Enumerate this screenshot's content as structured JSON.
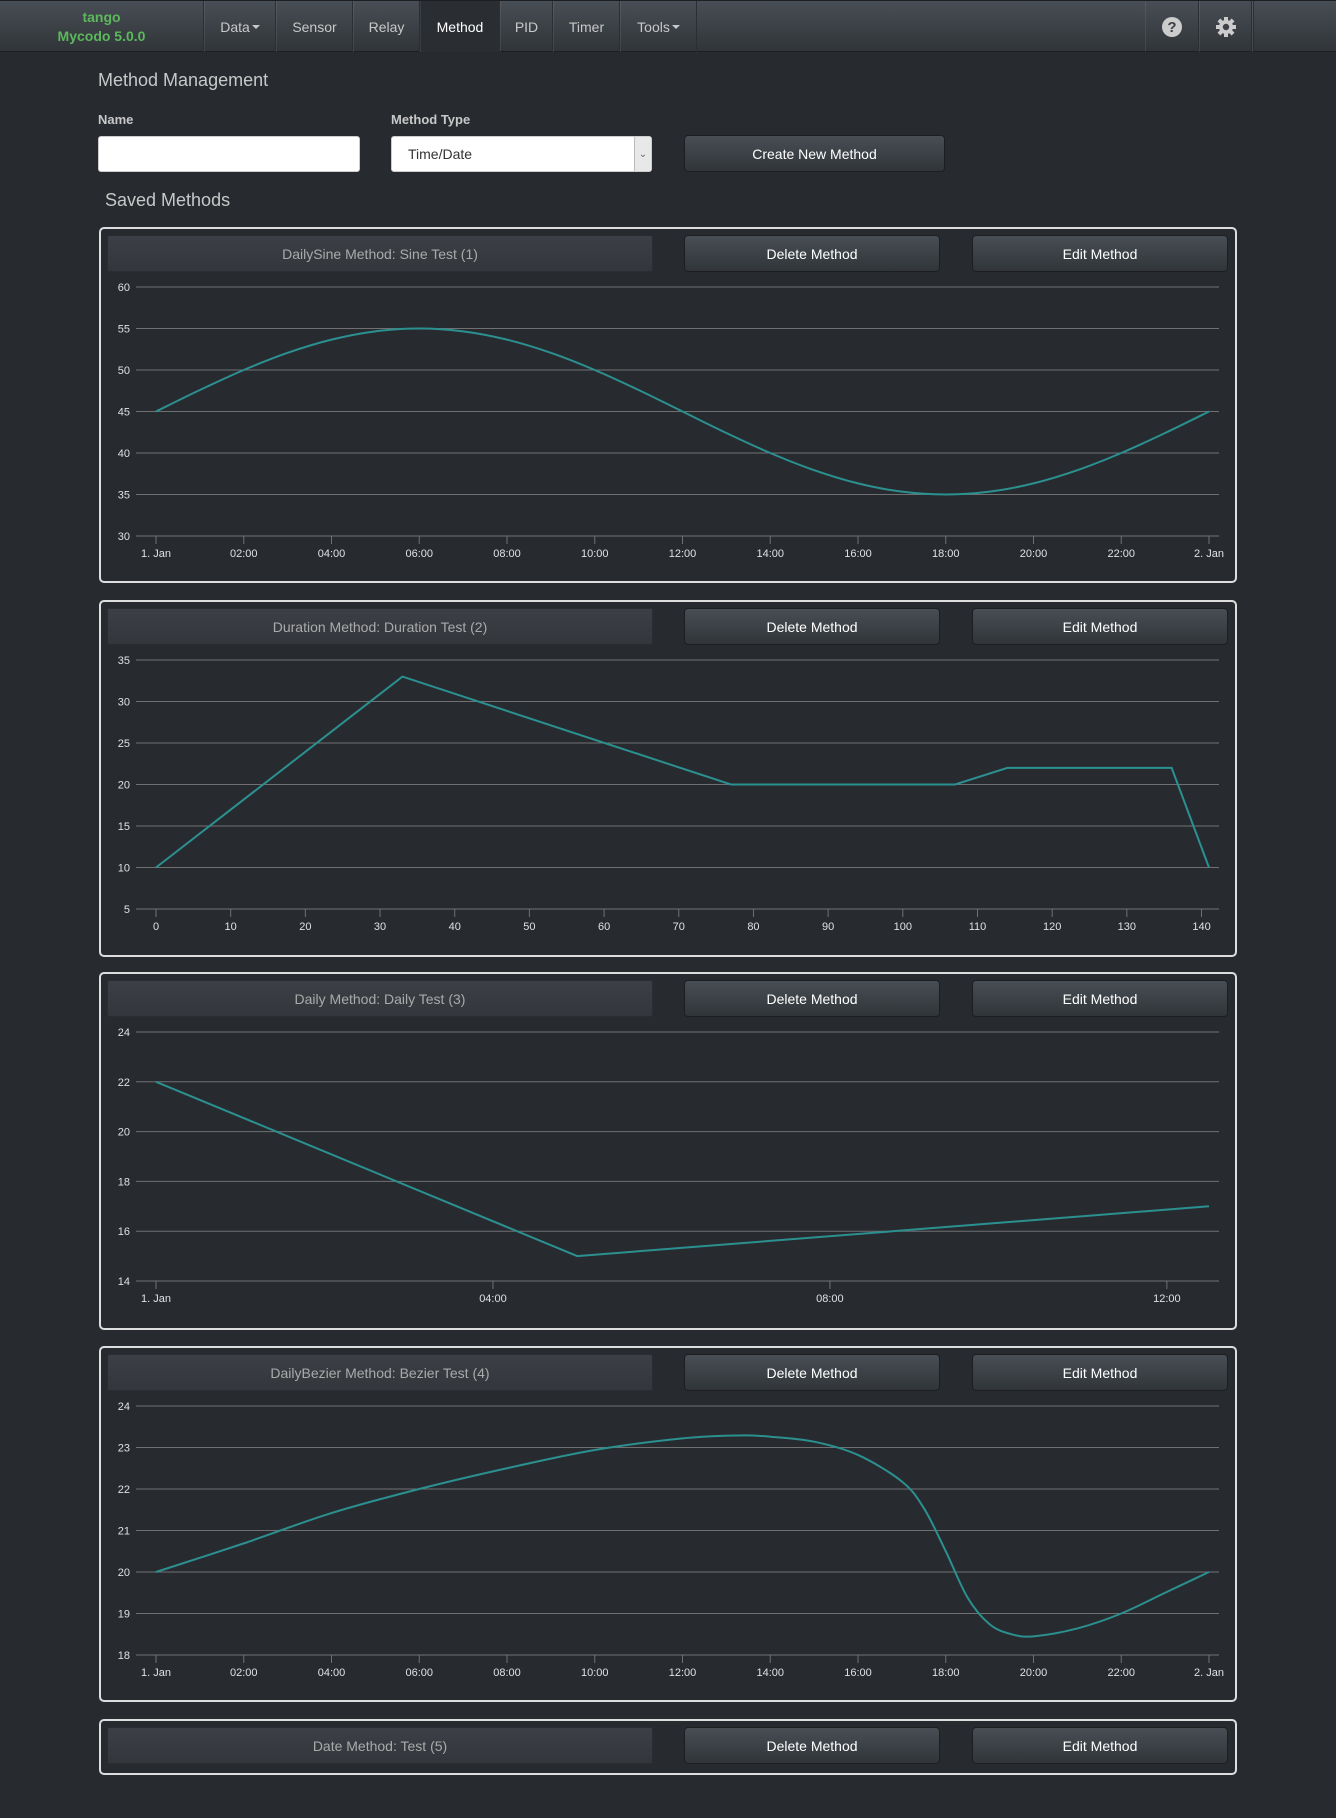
{
  "nav": {
    "brand_host": "tango",
    "brand_version": "Mycodo 5.0.0",
    "items": [
      {
        "label": "Data",
        "dropdown": true
      },
      {
        "label": "Sensor"
      },
      {
        "label": "Relay"
      },
      {
        "label": "Method",
        "active": true
      },
      {
        "label": "PID"
      },
      {
        "label": "Timer"
      },
      {
        "label": "Tools",
        "dropdown": true
      }
    ],
    "icons": [
      "help-icon",
      "gear-icon"
    ]
  },
  "form": {
    "page_title": "Method Management",
    "name_label": "Name",
    "name_value": "",
    "type_label": "Method Type",
    "type_value": "Time/Date",
    "create_label": "Create New Method"
  },
  "saved_title": "Saved Methods",
  "colors": {
    "line": "#2b908f",
    "grid": "#707073",
    "background": "#272b30"
  },
  "methods": [
    {
      "title": "DailySine Method: Sine Test (1)",
      "delete_label": "Delete Method",
      "edit_label": "Edit Method",
      "chart": {
        "type": "line",
        "curve": "smooth",
        "xaxis": "time",
        "ylim": [
          30,
          60
        ],
        "yticks": [
          30,
          35,
          40,
          45,
          50,
          55,
          60
        ],
        "xlim": [
          "00:00",
          "24:00"
        ],
        "xticks": [
          [
            "00:00",
            "1. Jan"
          ],
          [
            "02:00",
            "02:00"
          ],
          [
            "04:00",
            "04:00"
          ],
          [
            "06:00",
            "06:00"
          ],
          [
            "08:00",
            "08:00"
          ],
          [
            "10:00",
            "10:00"
          ],
          [
            "12:00",
            "12:00"
          ],
          [
            "14:00",
            "14:00"
          ],
          [
            "16:00",
            "16:00"
          ],
          [
            "18:00",
            "18:00"
          ],
          [
            "20:00",
            "20:00"
          ],
          [
            "22:00",
            "22:00"
          ],
          [
            "24:00",
            "2. Jan"
          ]
        ],
        "x": [
          "00:00",
          "01:00",
          "02:00",
          "03:00",
          "04:00",
          "05:00",
          "06:00",
          "07:00",
          "08:00",
          "09:00",
          "10:00",
          "11:00",
          "12:00",
          "13:00",
          "14:00",
          "15:00",
          "16:00",
          "17:00",
          "18:00",
          "19:00",
          "20:00",
          "21:00",
          "22:00",
          "23:00",
          "24:00"
        ],
        "y": [
          45,
          47.59,
          50,
          52.07,
          53.66,
          54.66,
          55,
          54.66,
          53.66,
          52.07,
          50,
          47.59,
          45,
          42.41,
          40,
          37.93,
          36.34,
          35.34,
          35,
          35.34,
          36.34,
          37.93,
          40,
          42.41,
          45
        ]
      }
    },
    {
      "title": "Duration Method: Duration Test (2)",
      "delete_label": "Delete Method",
      "edit_label": "Edit Method",
      "chart": {
        "type": "line",
        "curve": "linear",
        "xaxis": "number",
        "ylim": [
          5,
          35
        ],
        "yticks": [
          5,
          10,
          15,
          20,
          25,
          30,
          35
        ],
        "xlim": [
          0,
          141
        ],
        "xticks": [
          [
            0,
            "0"
          ],
          [
            10,
            "10"
          ],
          [
            20,
            "20"
          ],
          [
            30,
            "30"
          ],
          [
            40,
            "40"
          ],
          [
            50,
            "50"
          ],
          [
            60,
            "60"
          ],
          [
            70,
            "70"
          ],
          [
            80,
            "80"
          ],
          [
            90,
            "90"
          ],
          [
            100,
            "100"
          ],
          [
            110,
            "110"
          ],
          [
            120,
            "120"
          ],
          [
            130,
            "130"
          ],
          [
            140,
            "140"
          ]
        ],
        "x": [
          0,
          33,
          77,
          107,
          114,
          136,
          141
        ],
        "y": [
          10,
          33,
          20,
          20,
          22,
          22,
          10
        ]
      }
    },
    {
      "title": "Daily Method: Daily Test (3)",
      "delete_label": "Delete Method",
      "edit_label": "Edit Method",
      "chart": {
        "type": "line",
        "curve": "linear",
        "xaxis": "time",
        "ylim": [
          14,
          24
        ],
        "yticks": [
          14,
          16,
          18,
          20,
          22,
          24
        ],
        "xlim": [
          "00:00",
          "12:30"
        ],
        "xticks": [
          [
            "00:00",
            "1. Jan"
          ],
          [
            "04:00",
            "04:00"
          ],
          [
            "08:00",
            "08:00"
          ],
          [
            "12:00",
            "12:00"
          ]
        ],
        "x": [
          "00:00",
          "05:00",
          "12:30"
        ],
        "y": [
          22,
          15,
          17
        ]
      }
    },
    {
      "title": "DailyBezier Method: Bezier Test (4)",
      "delete_label": "Delete Method",
      "edit_label": "Edit Method",
      "chart": {
        "type": "line",
        "curve": "smooth",
        "xaxis": "time",
        "ylim": [
          18,
          24
        ],
        "yticks": [
          18,
          19,
          20,
          21,
          22,
          23,
          24
        ],
        "xlim": [
          "00:00",
          "24:00"
        ],
        "xticks": [
          [
            "00:00",
            "1. Jan"
          ],
          [
            "02:00",
            "02:00"
          ],
          [
            "04:00",
            "04:00"
          ],
          [
            "06:00",
            "06:00"
          ],
          [
            "08:00",
            "08:00"
          ],
          [
            "10:00",
            "10:00"
          ],
          [
            "12:00",
            "12:00"
          ],
          [
            "14:00",
            "14:00"
          ],
          [
            "16:00",
            "16:00"
          ],
          [
            "18:00",
            "18:00"
          ],
          [
            "20:00",
            "20:00"
          ],
          [
            "22:00",
            "22:00"
          ],
          [
            "24:00",
            "2. Jan"
          ]
        ],
        "x": [
          "00:00",
          "02:00",
          "04:00",
          "06:00",
          "08:00",
          "10:00",
          "12:00",
          "13:18",
          "14:00",
          "15:00",
          "16:00",
          "17:00",
          "17:30",
          "18:00",
          "18:30",
          "19:00",
          "19:30",
          "20:00",
          "21:00",
          "22:00",
          "23:00",
          "24:00"
        ],
        "y": [
          20,
          20.69,
          21.42,
          22.0,
          22.5,
          22.94,
          23.22,
          23.29,
          23.26,
          23.14,
          22.82,
          22.18,
          21.54,
          20.5,
          19.38,
          18.74,
          18.5,
          18.45,
          18.64,
          19.0,
          19.5,
          20
        ]
      }
    },
    {
      "title": "Date Method: Test (5)",
      "delete_label": "Delete Method",
      "edit_label": "Edit Method"
    }
  ]
}
